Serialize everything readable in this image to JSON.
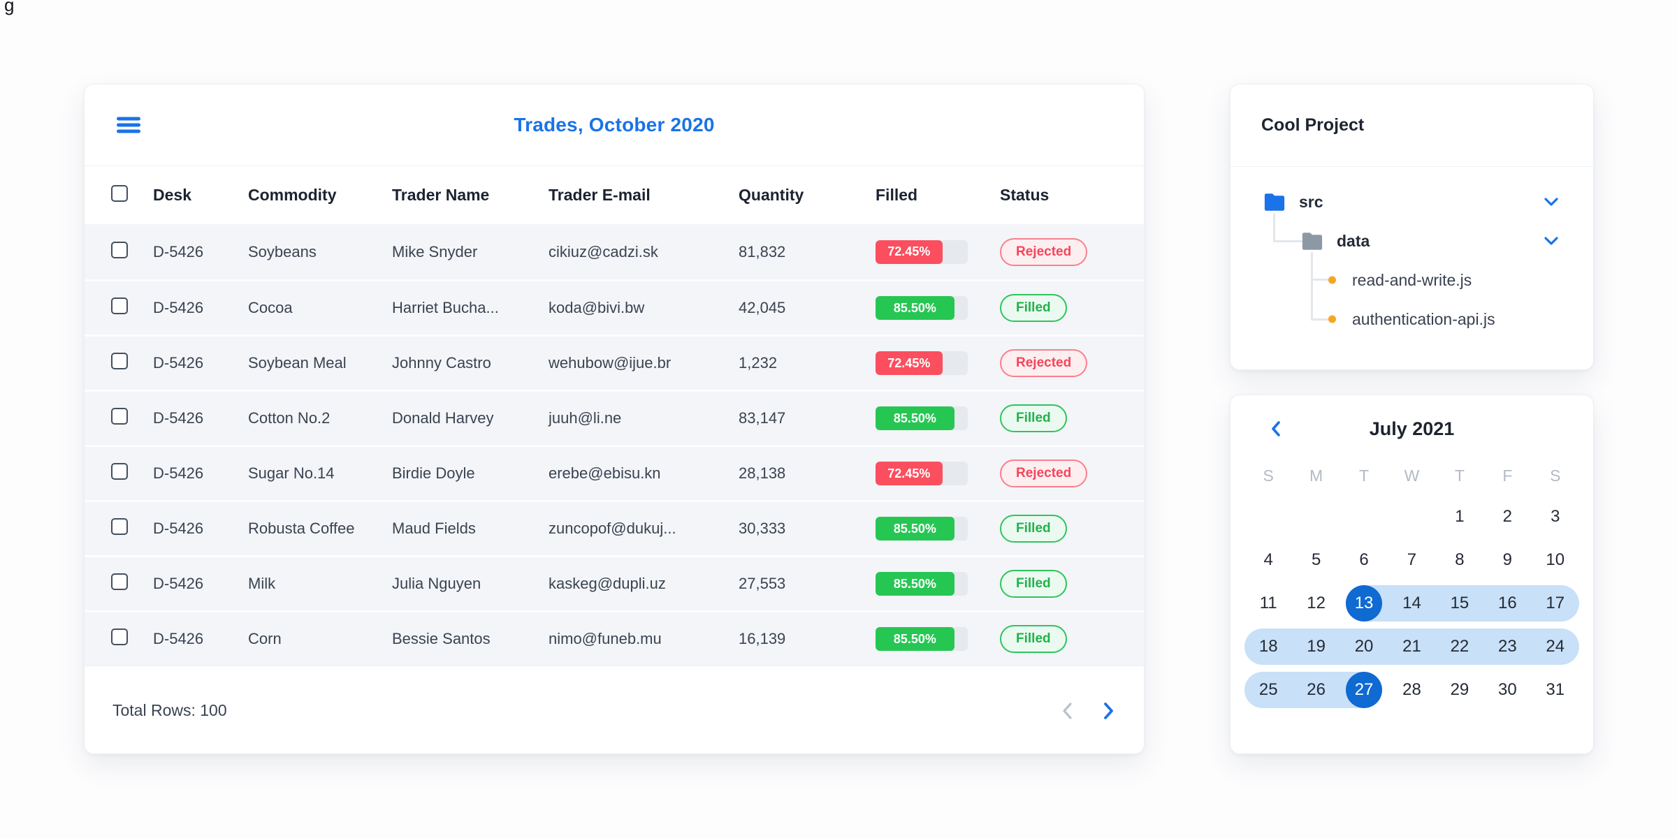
{
  "page": {
    "stray_glyph": "g"
  },
  "trades": {
    "title": "Trades, October 2020",
    "columns": {
      "desk": "Desk",
      "commodity": "Commodity",
      "trader": "Trader Name",
      "email": "Trader E-mail",
      "quantity": "Quantity",
      "filled": "Filled",
      "status": "Status"
    },
    "rows": [
      {
        "desk": "D-5426",
        "commodity": "Soybeans",
        "trader": "Mike Snyder",
        "email": "cikiuz@cadzi.sk",
        "quantity": "81,832",
        "filled_pct": "72.45%",
        "filled_value": 72.45,
        "status": "Rejected",
        "state": "rejected"
      },
      {
        "desk": "D-5426",
        "commodity": "Cocoa",
        "trader": "Harriet Bucha...",
        "email": "koda@bivi.bw",
        "quantity": "42,045",
        "filled_pct": "85.50%",
        "filled_value": 85.5,
        "status": "Filled",
        "state": "filled"
      },
      {
        "desk": "D-5426",
        "commodity": "Soybean Meal",
        "trader": "Johnny Castro",
        "email": "wehubow@ijue.br",
        "quantity": "1,232",
        "filled_pct": "72.45%",
        "filled_value": 72.45,
        "status": "Rejected",
        "state": "rejected"
      },
      {
        "desk": "D-5426",
        "commodity": "Cotton No.2",
        "trader": "Donald Harvey",
        "email": "juuh@li.ne",
        "quantity": "83,147",
        "filled_pct": "85.50%",
        "filled_value": 85.5,
        "status": "Filled",
        "state": "filled"
      },
      {
        "desk": "D-5426",
        "commodity": "Sugar No.14",
        "trader": "Birdie Doyle",
        "email": "erebe@ebisu.kn",
        "quantity": "28,138",
        "filled_pct": "72.45%",
        "filled_value": 72.45,
        "status": "Rejected",
        "state": "rejected"
      },
      {
        "desk": "D-5426",
        "commodity": "Robusta Coffee",
        "trader": "Maud Fields",
        "email": "zuncopof@dukuj...",
        "quantity": "30,333",
        "filled_pct": "85.50%",
        "filled_value": 85.5,
        "status": "Filled",
        "state": "filled"
      },
      {
        "desk": "D-5426",
        "commodity": "Milk",
        "trader": "Julia Nguyen",
        "email": "kaskeg@dupli.uz",
        "quantity": "27,553",
        "filled_pct": "85.50%",
        "filled_value": 85.5,
        "status": "Filled",
        "state": "filled"
      },
      {
        "desk": "D-5426",
        "commodity": "Corn",
        "trader": "Bessie Santos",
        "email": "nimo@funeb.mu",
        "quantity": "16,139",
        "filled_pct": "85.50%",
        "filled_value": 85.5,
        "status": "Filled",
        "state": "filled"
      }
    ],
    "footer": {
      "total": "Total Rows: 100"
    }
  },
  "project": {
    "title": "Cool Project",
    "items": [
      {
        "label": "src",
        "type": "folder"
      },
      {
        "label": "data",
        "type": "folder"
      },
      {
        "label": "read-and-write.js",
        "type": "file"
      },
      {
        "label": "authentication-api.js",
        "type": "file"
      }
    ]
  },
  "calendar": {
    "title": "July 2021",
    "weekdays": [
      "S",
      "M",
      "T",
      "W",
      "T",
      "F",
      "S"
    ],
    "weeks": [
      [
        "",
        "",
        "",
        "",
        "1",
        "2",
        "3"
      ],
      [
        "4",
        "5",
        "6",
        "7",
        "8",
        "9",
        "10"
      ],
      [
        "11",
        "12",
        "13",
        "14",
        "15",
        "16",
        "17"
      ],
      [
        "18",
        "19",
        "20",
        "21",
        "22",
        "23",
        "24"
      ],
      [
        "25",
        "26",
        "27",
        "28",
        "29",
        "30",
        "31"
      ]
    ],
    "range_start": "13",
    "range_end": "27"
  },
  "colors": {
    "accent_blue": "#1a73e8",
    "progress_red": "#fb4e5e",
    "progress_green": "#26c653",
    "selected_day_blue": "#0f6ad2",
    "range_band_blue": "#c8e0f8",
    "file_dot_orange": "#f5a623"
  }
}
